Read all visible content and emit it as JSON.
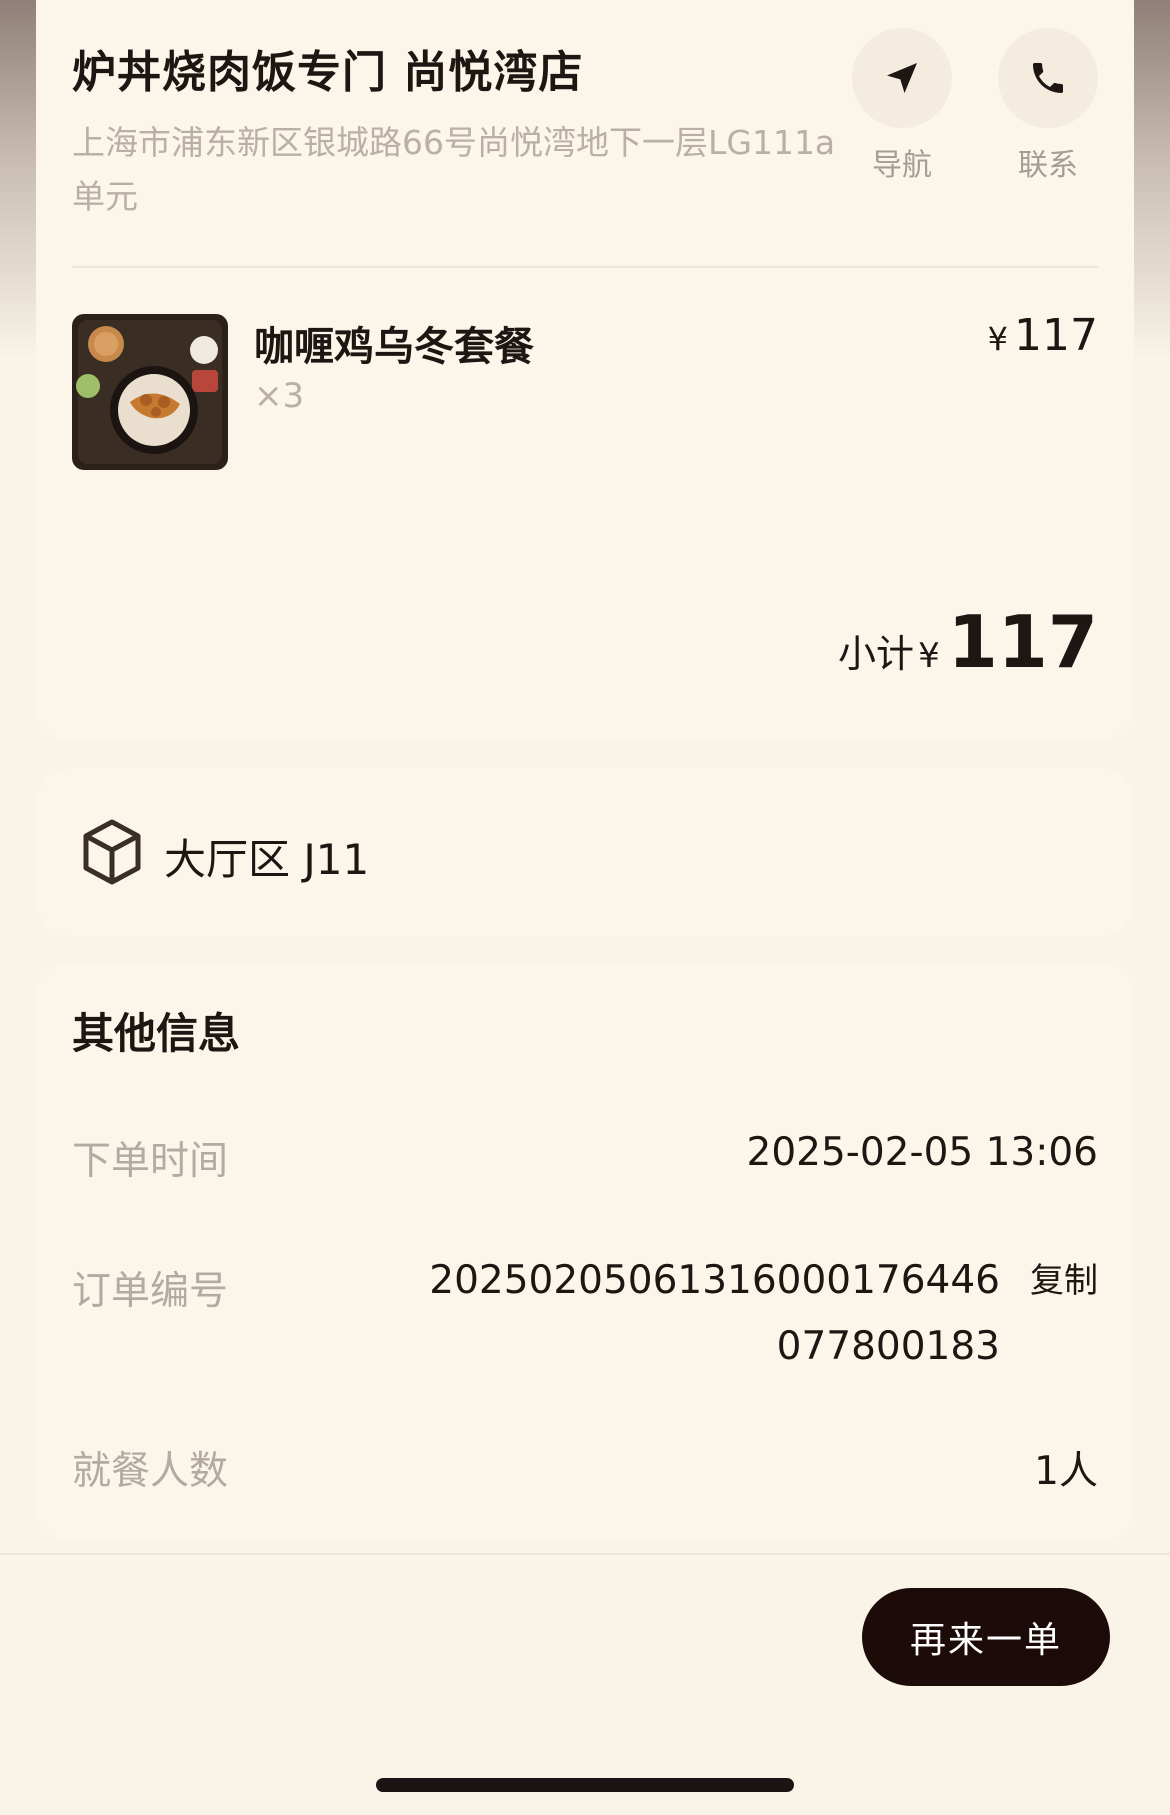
{
  "store": {
    "name": "炉丼烧肉饭专门 尚悦湾店",
    "address": "上海市浦东新区银城路66号尚悦湾地下一层LG111a单元",
    "actions": {
      "navigate": "导航",
      "call": "联系"
    }
  },
  "order_item": {
    "name": "咖喱鸡乌冬套餐",
    "quantity": "×3",
    "currency": "¥",
    "price": "117"
  },
  "subtotal": {
    "label": "小计",
    "currency": "¥",
    "amount": "117"
  },
  "table": {
    "icon": "box-icon",
    "text": "大厅区 J11"
  },
  "other_info": {
    "title": "其他信息",
    "order_time_label": "下单时间",
    "order_time_value": "2025-02-05 13:06",
    "order_number_label": "订单编号",
    "order_number_value": "2025020506131600017644607780018​3",
    "copy_label": "复制",
    "diners_label": "就餐人数",
    "diners_value": "1人"
  },
  "bottom": {
    "reorder_label": "再来一单"
  }
}
